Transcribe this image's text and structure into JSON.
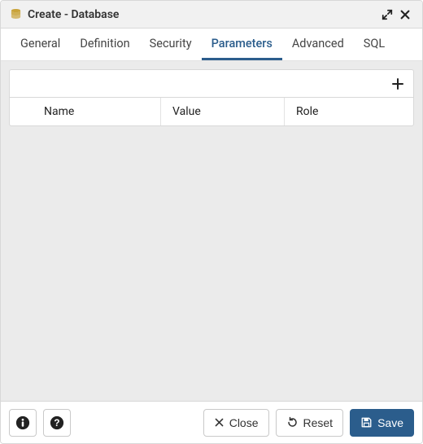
{
  "titlebar": {
    "title": "Create - Database"
  },
  "tabs": [
    {
      "label": "General",
      "active": false
    },
    {
      "label": "Definition",
      "active": false
    },
    {
      "label": "Security",
      "active": false
    },
    {
      "label": "Parameters",
      "active": true
    },
    {
      "label": "Advanced",
      "active": false
    },
    {
      "label": "SQL",
      "active": false
    }
  ],
  "parameters_grid": {
    "columns": {
      "name": "Name",
      "value": "Value",
      "role": "Role"
    },
    "rows": []
  },
  "footer": {
    "close_label": "Close",
    "reset_label": "Reset",
    "save_label": "Save"
  },
  "colors": {
    "accent": "#2b5d8c",
    "panel_bg": "#ebebeb",
    "title_bg": "#f1f1f1",
    "db_icon": "#c9a33a"
  }
}
